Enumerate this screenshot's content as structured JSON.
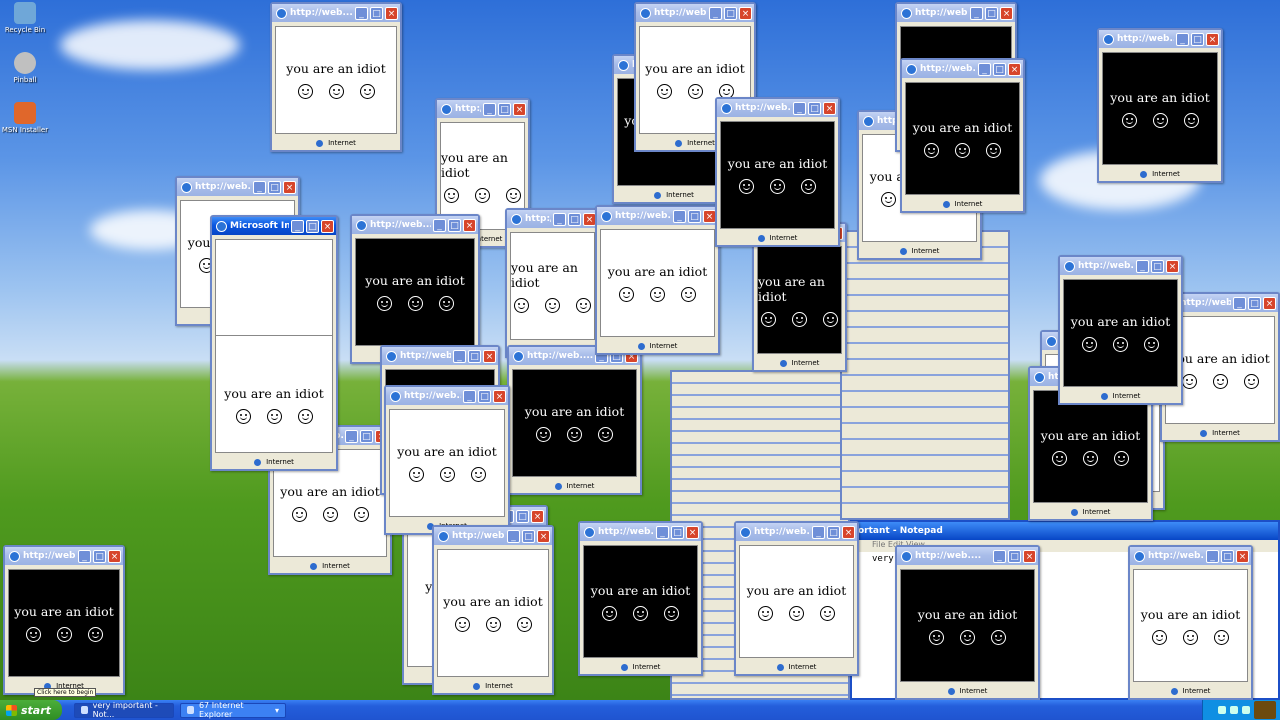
{
  "desktop": {
    "icons": [
      {
        "label": "Recycle Bin",
        "color": "#6fa7d8"
      },
      {
        "label": "Pinball",
        "color": "#c0c0c0"
      },
      {
        "label": "MSN Installer",
        "color": "#e0672b"
      }
    ]
  },
  "popup": {
    "title": "http://web....",
    "message": "you are an idiot",
    "status": "Internet"
  },
  "ie_window_title": "Microsoft In...",
  "notepad": {
    "title": "ortant - Notepad",
    "menu": "File  Edit  View",
    "text": "very im"
  },
  "tooltip": "Click here to begin",
  "taskbar": {
    "start": "start",
    "items": [
      {
        "label": "very important - Not..."
      },
      {
        "label": "67 Internet Explorer"
      }
    ]
  },
  "colors": {
    "xp_blue": "#245edb",
    "start_green": "#2f8d23",
    "close_red": "#d7452b"
  }
}
